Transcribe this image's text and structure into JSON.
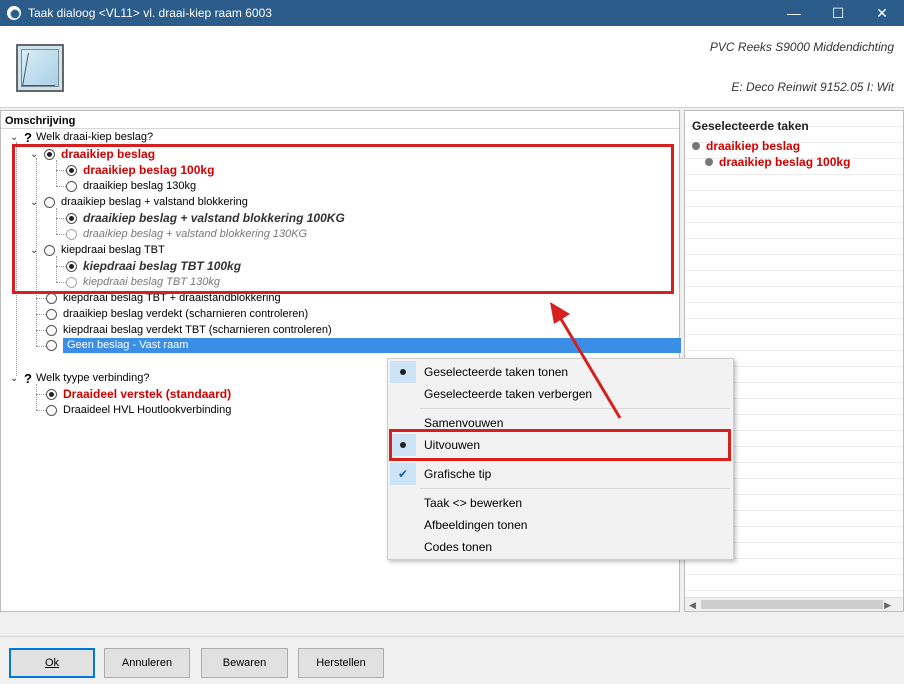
{
  "titlebar": {
    "title": "Taak dialoog <VL11> vl. draai-kiep raam 6003",
    "minimize": "—",
    "maximize": "☐",
    "close": "✕"
  },
  "header": {
    "product": "PVC Reeks S9000 Middendichting",
    "color": "E: Deco Reinwit 9152.05 I: Wit"
  },
  "tree": {
    "column_header": "Omschrijving",
    "q1": "Welk draai-kiep beslag?",
    "q1_items": {
      "draaikiep": "draaikiep beslag",
      "draaikiep_100": "draaikiep beslag 100kg",
      "draaikiep_130": "draaikiep beslag 130kg",
      "valstand": "draaikiep beslag + valstand blokkering",
      "valstand_100": "draaikiep beslag + valstand blokkering 100KG",
      "valstand_130": "draaikiep beslag + valstand blokkering 130KG",
      "tbt": "kiepdraai beslag TBT",
      "tbt_100": "kiepdraai beslag TBT 100kg",
      "tbt_130": "kiepdraai beslag TBT 130kg",
      "tbt_draai": "kiepdraai beslag TBT + draaistandblokkering",
      "verdekt": "draaikiep beslag verdekt (scharnieren controleren)",
      "tbt_verdekt": "kiepdraai beslag verdekt TBT (scharnieren controleren)",
      "geen": "Geen beslag - Vast raam"
    },
    "q2": "Welk tyype verbinding?",
    "q2_items": {
      "verstek": "Draaideel verstek (standaard)",
      "hvl": "Draaideel HVL Houtlookverbinding"
    }
  },
  "right_panel": {
    "title": "Geselecteerde taken",
    "item1": "draaikiep beslag",
    "item2": "draaikiep beslag 100kg"
  },
  "context_menu": {
    "items": [
      "Geselecteerde taken tonen",
      "Geselecteerde taken verbergen",
      "Samenvouwen",
      "Uitvouwen",
      "Grafische tip",
      "Taak <> bewerken",
      "Afbeeldingen tonen",
      "Codes tonen"
    ]
  },
  "buttons": {
    "ok": "Ok",
    "annuleren": "Annuleren",
    "bewaren": "Bewaren",
    "herstellen": "Herstellen"
  },
  "colors": {
    "accent_red": "#d40000",
    "selection_blue": "#3a8ee6",
    "annotation_red": "#d62020"
  }
}
